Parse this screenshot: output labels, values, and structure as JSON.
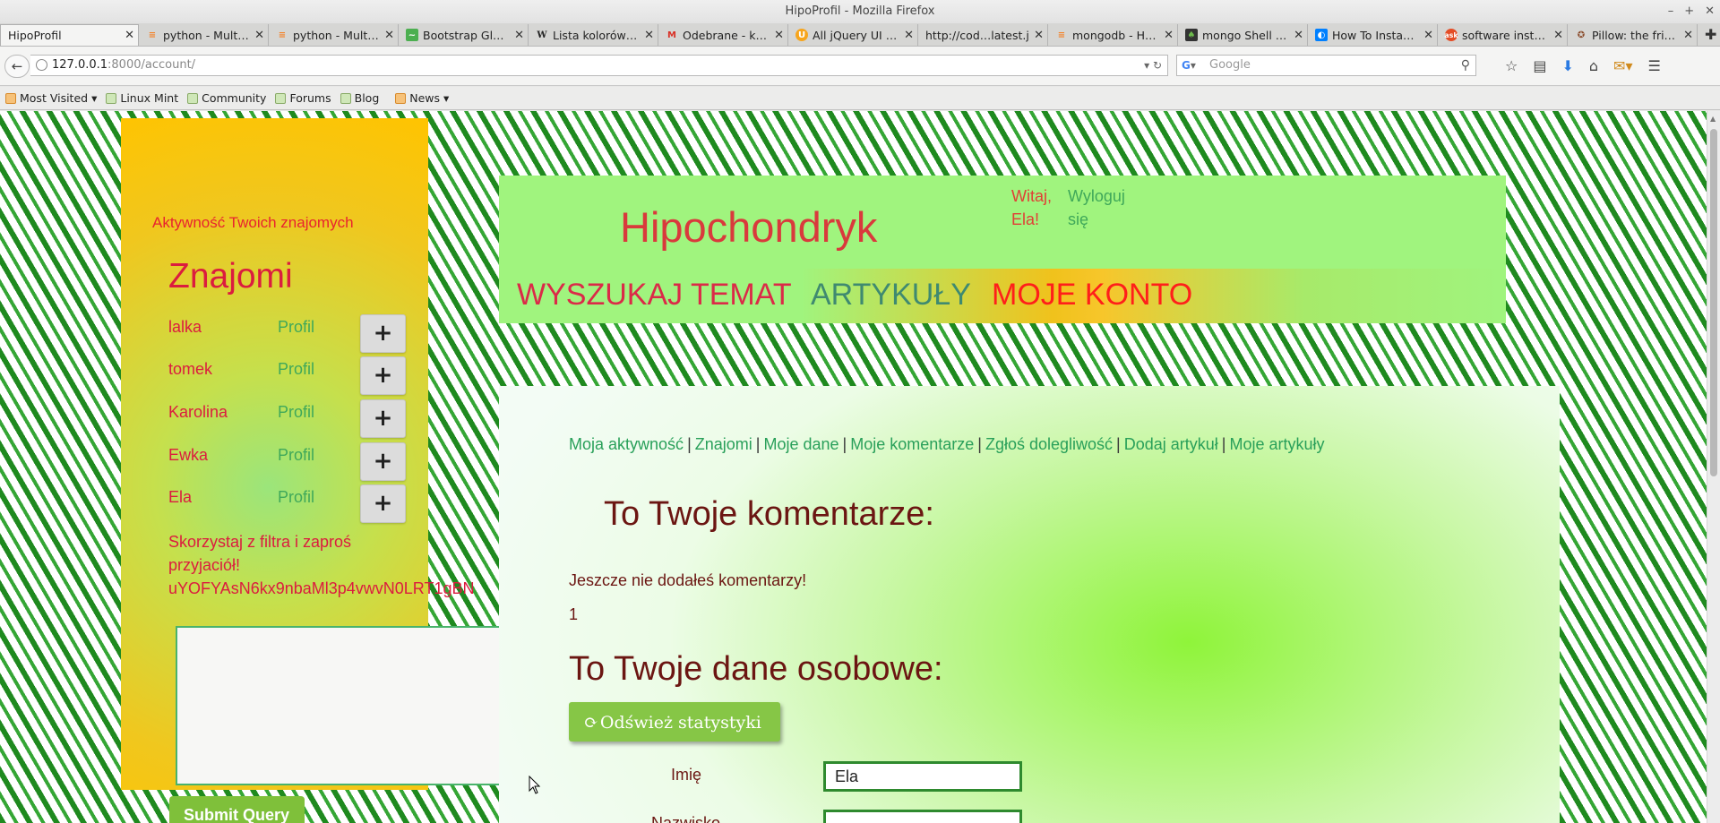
{
  "window": {
    "title": "HipoProfil - Mozilla Firefox",
    "controls": [
      "–",
      "+",
      "✕"
    ]
  },
  "tabs": [
    {
      "label": "HipoProfil",
      "icon": "none",
      "active": true
    },
    {
      "label": "python - Mult…",
      "icon": "stack-overflow-icon",
      "color": "#f48024"
    },
    {
      "label": "python - Mult…",
      "icon": "stack-overflow-icon",
      "color": "#f48024"
    },
    {
      "label": "Bootstrap Gl…",
      "icon": "bootstrap-icon",
      "color": "#4caf50"
    },
    {
      "label": "Lista kolorów…",
      "icon": "wikipedia-icon",
      "color": "#222222"
    },
    {
      "label": "Odebrane - k…",
      "icon": "gmail-icon",
      "color": "#d93025"
    },
    {
      "label": "All jQuery UI …",
      "icon": "jquery-icon",
      "color": "#f7a51c"
    },
    {
      "label": "http://cod…latest.js",
      "icon": "none"
    },
    {
      "label": "mongodb - H…",
      "icon": "stack-overflow-icon",
      "color": "#f48024"
    },
    {
      "label": "mongo Shell …",
      "icon": "mongodb-icon",
      "color": "#3f7d2e"
    },
    {
      "label": "How To Insta…",
      "icon": "digitalocean-icon",
      "color": "#0080ff"
    },
    {
      "label": "software inst…",
      "icon": "askubuntu-icon",
      "color": "#e44d26"
    },
    {
      "label": "Pillow: the fri…",
      "icon": "python-icon",
      "color": "#8a4b2b"
    }
  ],
  "tab_close": "✕",
  "new_tab": "✚",
  "navbar": {
    "back": "←",
    "url_host": "127.0.0.1",
    "url_path": ":8000/account/",
    "reload": "↻",
    "dropdown": "▾",
    "search_engine": "G",
    "search_placeholder": "Google",
    "search_icon": "⚲"
  },
  "bookmarks": [
    "Most Visited",
    "Linux Mint",
    "Community",
    "Forums",
    "Blog",
    "News"
  ],
  "sidebar": {
    "activity": "Aktywność Twoich znajomych",
    "title": "Znajomi",
    "friends": [
      {
        "name": "lalka",
        "profile": "Profil"
      },
      {
        "name": "tomek",
        "profile": "Profil"
      },
      {
        "name": "Karolina",
        "profile": "Profil"
      },
      {
        "name": "Ewka",
        "profile": "Profil"
      },
      {
        "name": "Ela",
        "profile": "Profil"
      }
    ],
    "add_label": "+",
    "invite_line1": "Skorzystaj z filtra i zaproś",
    "invite_line2": "przyjaciół!",
    "invite_token": "uYOFYAsN6kx9nbaMl3p4vwvN0LRT1gBN",
    "submit": "Submit Query"
  },
  "header": {
    "site_title": "Hipochondryk",
    "greeting": "Witaj, Ela!",
    "logout": "Wyloguj się",
    "nav": [
      "WYSZUKAJ TEMAT",
      "ARTYKUŁY",
      "MOJE KONTO"
    ]
  },
  "content": {
    "subnav": [
      "Moja aktywność",
      "Znajomi",
      "Moje dane",
      "Moje komentarze",
      "Zgłoś dolegliwość",
      "Dodaj artykuł",
      "Moje artykuły"
    ],
    "separator": "|",
    "comments_title": "To Twoje komentarze:",
    "no_comments": "Jeszcze nie dodałeś komentarzy!",
    "count": "1",
    "personal_title": "To Twoje dane osobowe:",
    "refresh_button": "Odśwież   statystyki",
    "refresh_icon": "⟳",
    "fields": [
      {
        "label": "Imię",
        "value": "Ela"
      },
      {
        "label": "Nazwisko",
        "value": ""
      }
    ]
  },
  "colors": {
    "sidebar_accent": "#ffc400",
    "header_bg": "#a0f47e",
    "link_green": "#29a05a",
    "title_red": "#d93a3c",
    "heading_maroon": "#6b1612",
    "button_green": "#86c646"
  }
}
